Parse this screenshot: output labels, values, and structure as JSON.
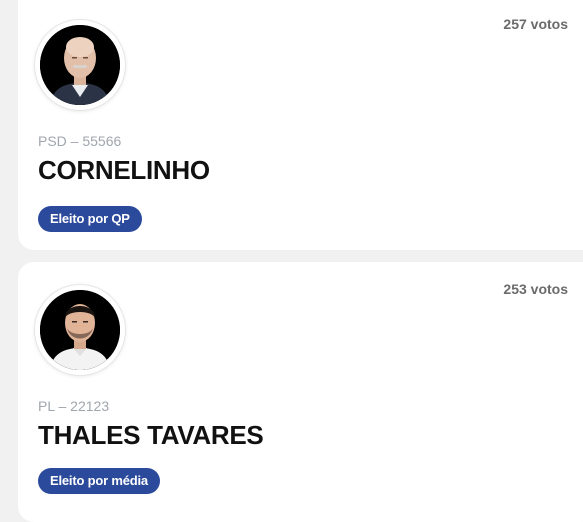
{
  "candidates": [
    {
      "votes": "257 votos",
      "party": "PSD – 55566",
      "name": "CORNELINHO",
      "status": "Eleito por QP"
    },
    {
      "votes": "253 votos",
      "party": "PL – 22123",
      "name": "THALES TAVARES",
      "status": "Eleito por média"
    }
  ],
  "colors": {
    "badge": "#2c4a9c",
    "page_background": "#f1f1f1",
    "card_background": "#ffffff"
  }
}
